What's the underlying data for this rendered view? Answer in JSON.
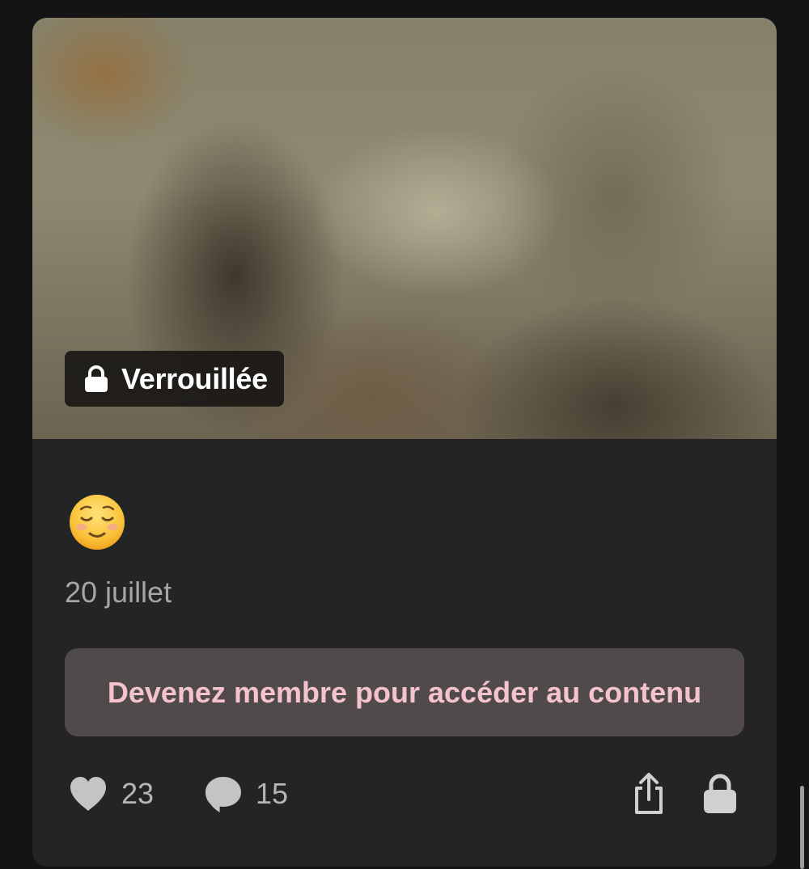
{
  "post": {
    "locked_label": "Verrouillée",
    "date": "20 juillet",
    "cta_label": "Devenez membre pour accéder au contenu",
    "emoji_icon": "relieved-face-emoji"
  },
  "actions": {
    "likes": "23",
    "comments": "15"
  },
  "colors": {
    "background": "#141414",
    "card": "#242424",
    "cta_bg": "#504a4b",
    "cta_text": "#f5c3cf",
    "muted_text": "#a5a5a5"
  }
}
